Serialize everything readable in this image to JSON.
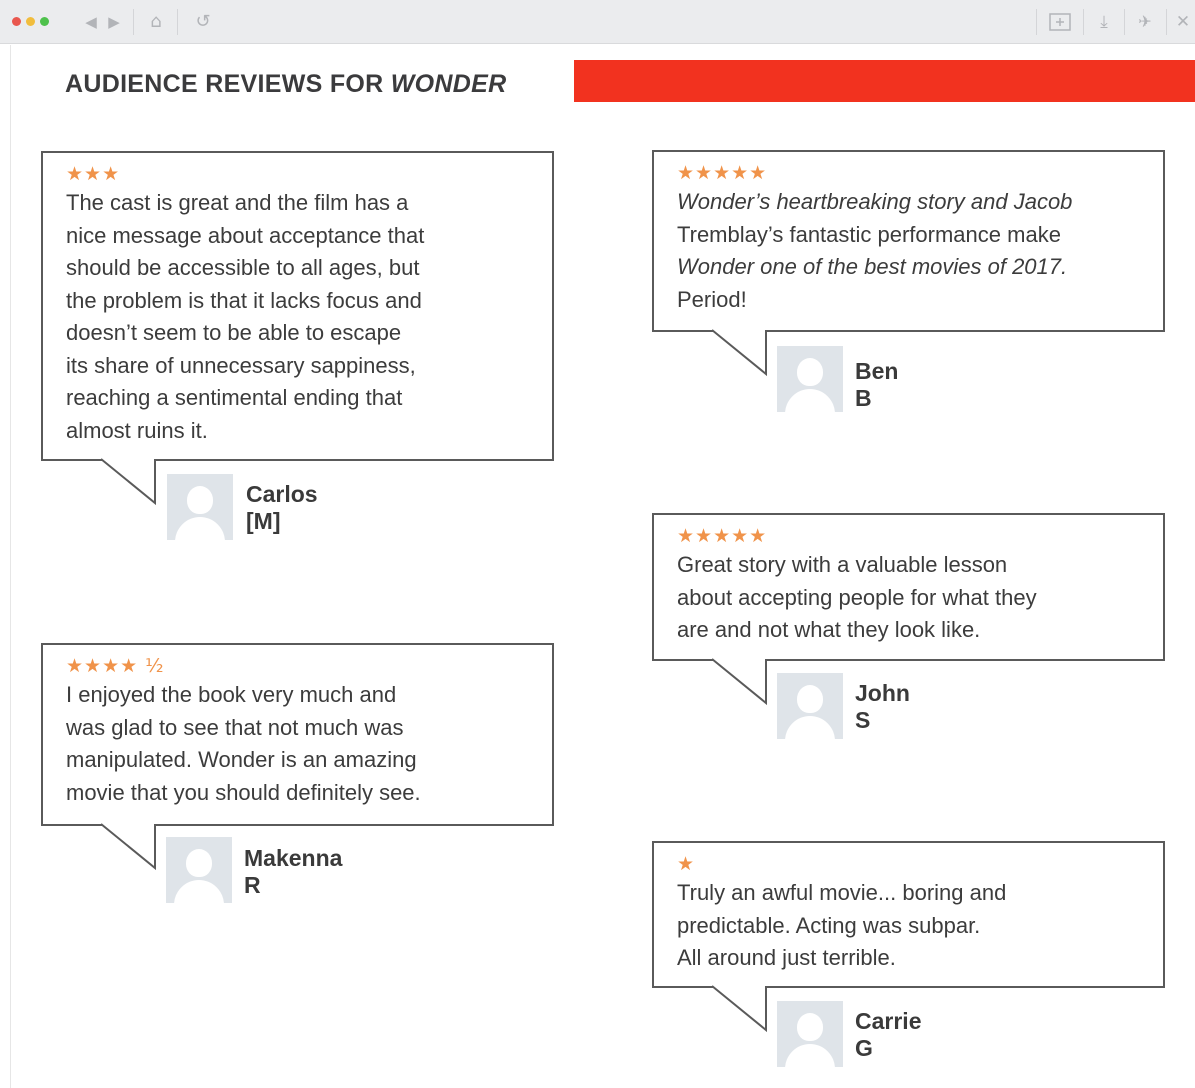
{
  "browser": {
    "icons": [
      "back-arrow-icon",
      "forward-arrow-icon",
      "home-icon",
      "reload-icon",
      "new-tab-icon",
      "download-icon",
      "extension-icon",
      "close-icon"
    ]
  },
  "page": {
    "title_prefix": "AUDIENCE REVIEWS FOR ",
    "title_film": "WONDER",
    "accent_color": "#f2321f",
    "star_color": "#f0934a"
  },
  "reviews": [
    {
      "stars": "★★★",
      "rating": 3,
      "author": "Carlos [M]",
      "lines": [
        "The cast is great and the film has a",
        "nice message about acceptance that",
        "should be accessible to all ages, but",
        "the problem is that it lacks focus and",
        "doesn’t seem to be able to escape",
        "its share of unnecessary sappiness,",
        "reaching a sentimental ending that",
        "almost ruins it."
      ]
    },
    {
      "stars": "★★★★★",
      "rating": 5,
      "author": "Ben B",
      "lines": [
        "Wonder’s heartbreaking story and Jacob",
        "Tremblay’s fantastic performance make",
        "Wonder one of the best movies of 2017.",
        "Period!"
      ]
    },
    {
      "stars": "★★★★★",
      "rating": 5,
      "author": "John S",
      "lines": [
        "Great story with a valuable lesson",
        "about accepting people for what they",
        "are and not what they look like."
      ]
    },
    {
      "stars": "★★★★ ½",
      "rating": 4.5,
      "author": "Makenna R",
      "lines": [
        "I enjoyed the book very much and",
        "was glad to see that not much was",
        "manipulated. Wonder is an amazing",
        "movie that you should definitely see."
      ]
    },
    {
      "stars": "★",
      "rating": 1,
      "author": "Carrie G",
      "lines": [
        "Truly an awful movie... boring and",
        "predictable. Acting was subpar.",
        "All around just terrible."
      ]
    }
  ]
}
